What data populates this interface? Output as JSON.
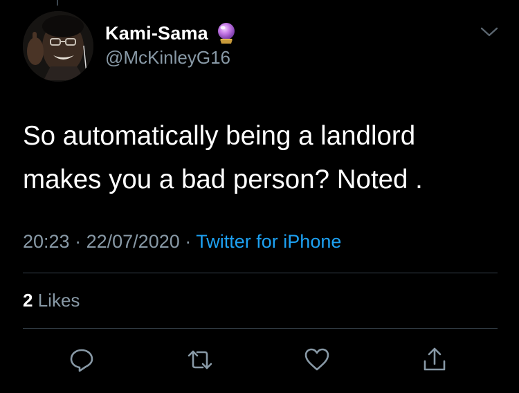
{
  "tweet": {
    "display_name": "Kami-Sama",
    "handle": "@McKinleyG16",
    "text": "So automatically being a landlord makes you a bad person? Noted .",
    "time": "20:23",
    "date": "22/07/2020",
    "separator": "·",
    "source": "Twitter for iPhone",
    "likes_count": "2",
    "likes_label": "Likes"
  },
  "icons": {
    "name_emoji": "crystal-ball-icon",
    "menu": "chevron-down-icon",
    "actions": [
      "reply-icon",
      "retweet-icon",
      "like-icon",
      "share-icon"
    ]
  },
  "colors": {
    "background": "#000000",
    "primary_text": "#ffffff",
    "secondary_text": "#8899a6",
    "accent": "#1da1f2",
    "divider": "#38444d"
  }
}
